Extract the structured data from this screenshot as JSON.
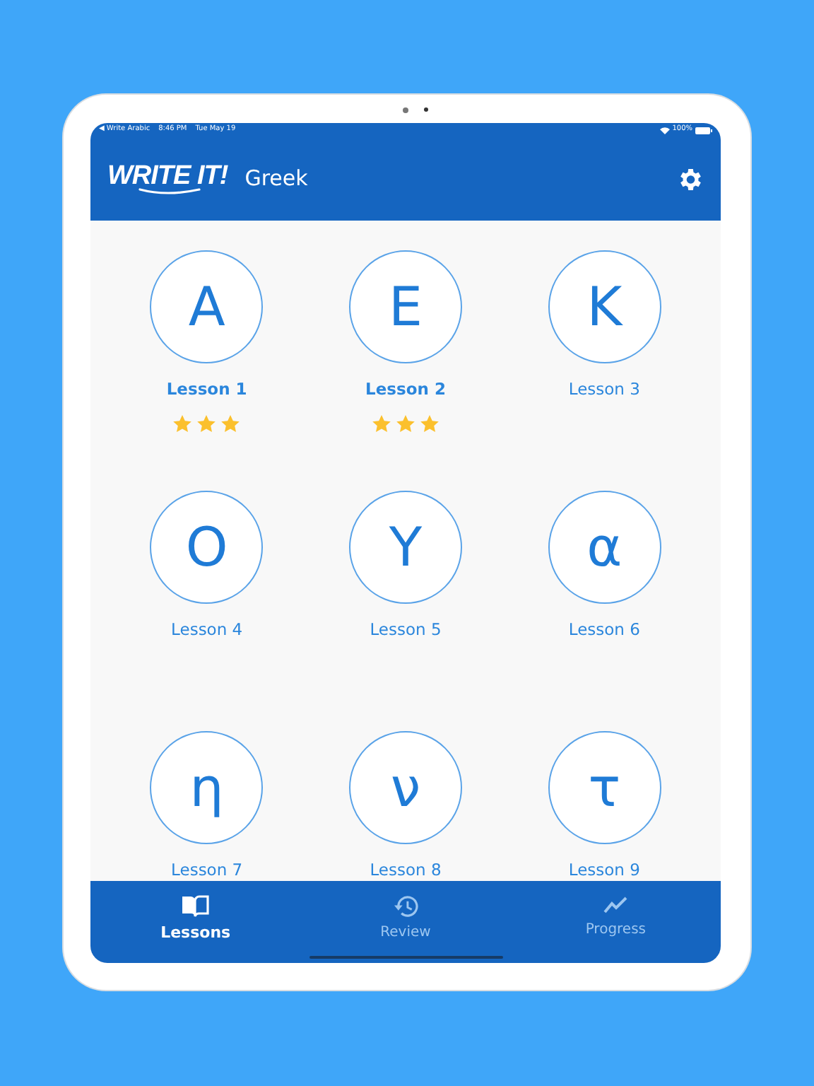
{
  "status_bar": {
    "back": "◀ Write Arabic",
    "time": "8:46 PM",
    "date": "Tue May 19",
    "battery": "100%"
  },
  "header": {
    "logo": "WRITE IT!",
    "title": "Greek"
  },
  "lessons": [
    {
      "letter": "Α",
      "label": "Lesson 1",
      "completed": true,
      "stars": 3
    },
    {
      "letter": "Ε",
      "label": "Lesson 2",
      "completed": true,
      "stars": 3
    },
    {
      "letter": "Κ",
      "label": "Lesson 3",
      "completed": false
    },
    {
      "letter": "Ο",
      "label": "Lesson 4",
      "completed": false
    },
    {
      "letter": "Υ",
      "label": "Lesson 5",
      "completed": false
    },
    {
      "letter": "α",
      "label": "Lesson 6",
      "completed": false
    },
    {
      "letter": "η",
      "label": "Lesson 7",
      "completed": false
    },
    {
      "letter": "ν",
      "label": "Lesson 8",
      "completed": false
    },
    {
      "letter": "τ",
      "label": "Lesson 9",
      "completed": false
    }
  ],
  "tabs": [
    {
      "label": "Lessons",
      "kind": "book",
      "selected": true
    },
    {
      "label": "Review",
      "kind": "history",
      "selected": false
    },
    {
      "label": "Progress",
      "kind": "chart",
      "selected": false
    }
  ]
}
